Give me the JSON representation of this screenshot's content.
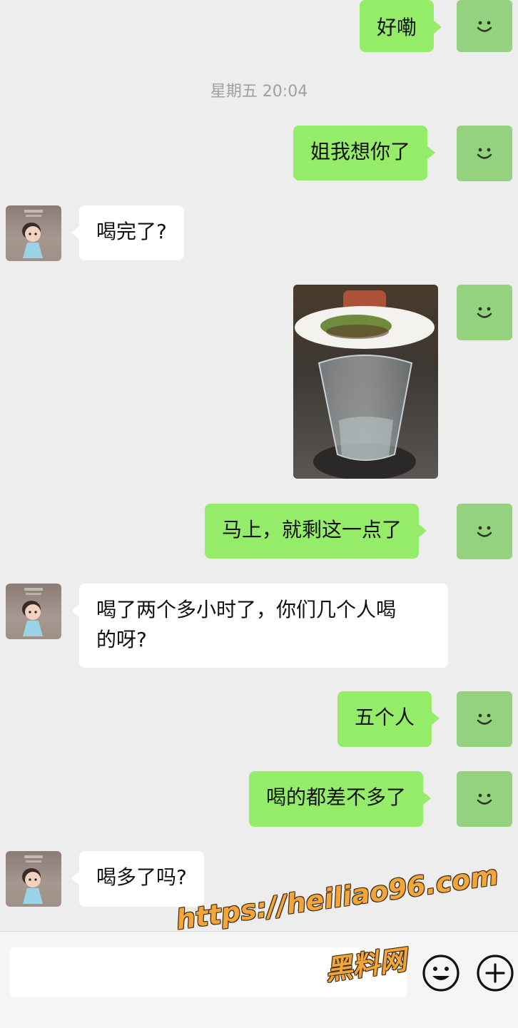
{
  "timestamp": "星期五 20:04",
  "messages": [
    {
      "side": "out",
      "text": "好嘞"
    },
    {
      "side": "out",
      "text": "姐我想你了"
    },
    {
      "side": "in",
      "text": "喝完了?"
    },
    {
      "side": "out",
      "type": "image",
      "alt": "glass-of-liquor-photo"
    },
    {
      "side": "out",
      "text": "马上，就剩这一点了"
    },
    {
      "side": "in",
      "text": "喝了两个多小时了，你们几个人喝\n的呀?"
    },
    {
      "side": "out",
      "text": "五个人"
    },
    {
      "side": "out",
      "text": "喝的都差不多了"
    },
    {
      "side": "in",
      "text": "喝多了吗?"
    }
  ],
  "watermark": {
    "url": "https://heiliao96.com",
    "name": "黑料网"
  },
  "colors": {
    "outgoing_bubble": "#95ec69",
    "incoming_bubble": "#ffffff",
    "background": "#ededed"
  },
  "icons": {
    "emoji": "emoji-icon",
    "add": "plus-circle-icon"
  }
}
